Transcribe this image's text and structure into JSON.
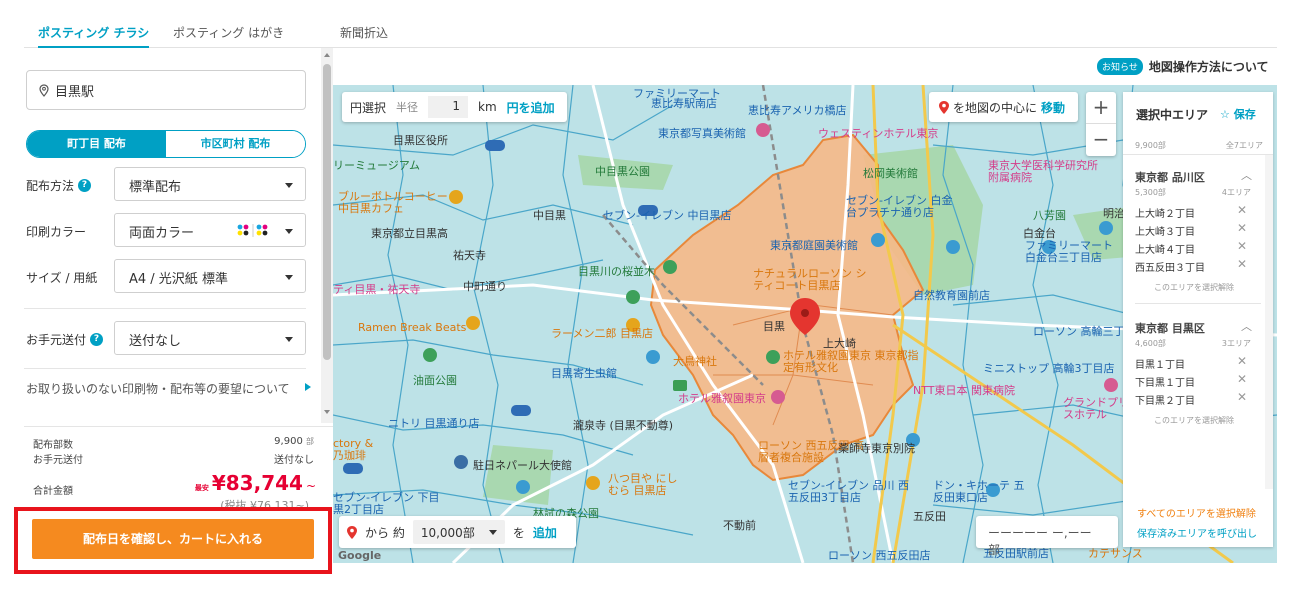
{
  "tabs": [
    "ポスティング チラシ",
    "ポスティング はがき",
    "新聞折込"
  ],
  "left": {
    "station": "目黒駅",
    "toggle": {
      "on": "町丁目 配布",
      "off": "市区町村 配布"
    },
    "rows": [
      {
        "label": "配布方法",
        "help": true,
        "value": "標準配布"
      },
      {
        "label": "印刷カラー",
        "help": false,
        "value": "両面カラー"
      },
      {
        "label": "サイズ / 用紙",
        "help": false,
        "value": "A4 / 光沢紙 標準"
      },
      {
        "label": "お手元送付",
        "help": true,
        "value": "送付なし"
      }
    ],
    "help_icon": "?",
    "note": "お取り扱いのない印刷物・配布等の要望について",
    "summary": {
      "count_label": "配布部数",
      "count_value": "9,900",
      "count_unit": "部",
      "send_label": "お手元送付",
      "send_value": "送付なし",
      "total_label": "合計金額",
      "price_prefix": "最安",
      "price": "¥83,744",
      "price_suffix": "~",
      "strike": "(税抜 ¥76,131~)"
    },
    "cta": "配布日を確認し、カートに入れる"
  },
  "map": {
    "circle": {
      "label": "円選択",
      "radius_label": "半径",
      "radius": "1",
      "unit": "km",
      "add": "円を追加"
    },
    "center": {
      "label": "を地図の中心に",
      "move": "移動"
    },
    "zoom_in": "+",
    "zoom_out": "−",
    "count": {
      "from": "から 約",
      "value": "10,000部",
      "wo": "を",
      "add": "追加"
    },
    "date": "ーーーーー ー,ーー 部",
    "labels": [
      "恵比寿駅南店",
      "恵比寿アメリカ橋店",
      "ファミリーマート",
      "東京都写真美術館",
      "ウェスティンホテル東京",
      "目黒区役所",
      "中目黒公園",
      "松岡美術館",
      "東京大学医科学研究所附属病院",
      "リーミュージアム",
      "ブルーボトルコーヒー 中目黒カフェ",
      "東京都立目黒高",
      "祐天寺",
      "中目黒",
      "セブン-イレブン 中目黒店",
      "セブン-イレブン 白金台プラチナ通り店",
      "東京都庭園美術館",
      "八芳園",
      "明治学院",
      "白金台",
      "ファミリーマート 白金台三丁目店",
      "目黒川の桜並木",
      "ナチュラルローソン シティコート目黒店",
      "自然教育園前店",
      "ティ目黒・祐天寺",
      "中町通り",
      "Ramen Break Beats",
      "ラーメン二郎 目黒店",
      "目黒",
      "上大崎",
      "ローソン 高輪三丁目",
      "大鳥神社",
      "ホテル雅叙園東京 東京都指定有形文化",
      "ミニストップ 高輪3丁目店",
      "油面公園",
      "目黒寄生虫館",
      "NTT東日本 関東病院",
      "グランドプリンスホテル",
      "ニトリ 目黒通り店",
      "瀧泉寺 (目黒不動尊)",
      "ホテル雅叙園東京",
      "ctory & 乃珈琲",
      "ローソン 西五反田 高層者複合施設",
      "薬師寺東京別院",
      "駐日ネパール大使館",
      "八つ目や にしむら 目黒店",
      "セブン-イレブン 品川 西五反田3丁目店",
      "ドン・キホーテ 五反田東口店",
      "林試の森公園",
      "不動前",
      "五反田",
      "セブン-イレブン 下目黒2丁目店",
      "ローソン 西五反田店",
      "五反田駅前店",
      "カテサンス",
      "Google"
    ]
  },
  "right": {
    "notice_badge": "お知らせ",
    "notice_text": "地図操作方法について",
    "title": "選択中エリア",
    "save": "☆ 保存",
    "total": "9,900部",
    "total_areas": "全7エリア",
    "groups": [
      {
        "name": "東京都 品川区",
        "count": "5,300部",
        "areas": "4エリア",
        "items": [
          "上大崎２丁目",
          "上大崎３丁目",
          "上大崎４丁目",
          "西五反田３丁目"
        ],
        "deselect": "このエリアを選択解除"
      },
      {
        "name": "東京都 目黒区",
        "count": "4,600部",
        "areas": "3エリア",
        "items": [
          "目黒１丁目",
          "下目黒１丁目",
          "下目黒２丁目"
        ],
        "deselect": "このエリアを選択解除"
      }
    ],
    "footer1": "すべてのエリアを選択解除",
    "footer2": "保存済みエリアを呼び出し"
  }
}
